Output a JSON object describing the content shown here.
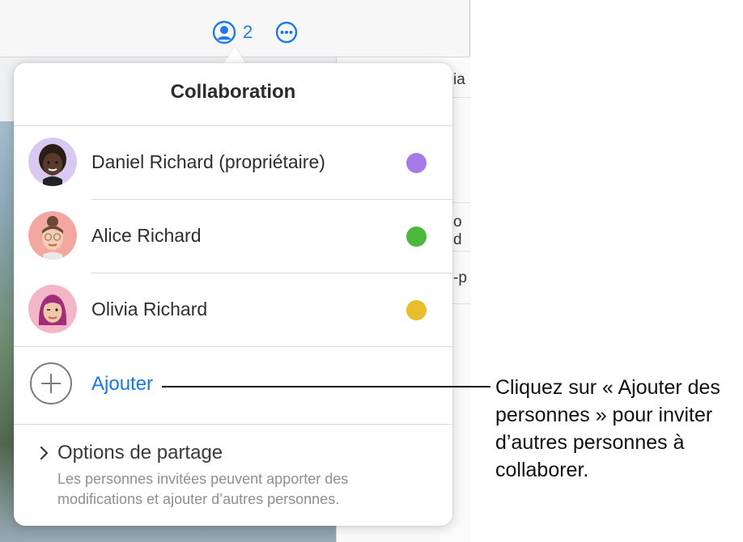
{
  "toolbar": {
    "collaborator_count": "2",
    "collab_icon": "person-circle-icon",
    "more_icon": "ellipsis-circle-icon"
  },
  "background_fragments": {
    "frag1": "ia",
    "frag2": "o d",
    "frag3": "-p"
  },
  "popover": {
    "title": "Collaboration",
    "people": [
      {
        "name": "Daniel Richard (propriétaire)",
        "color": "#a57bea",
        "avatar_icon": "memoji-avatar-icon"
      },
      {
        "name": "Alice Richard",
        "color": "#4cb93c",
        "avatar_icon": "memoji-avatar-icon"
      },
      {
        "name": "Olivia Richard",
        "color": "#e6bf2a",
        "avatar_icon": "memoji-avatar-icon"
      }
    ],
    "add": {
      "label": "Ajouter",
      "icon": "plus-circle-icon"
    },
    "options": {
      "chevron_icon": "chevron-right-icon",
      "title": "Options de partage",
      "description": "Les personnes invitées peuvent apporter des modifications et ajouter d’autres personnes."
    }
  },
  "callout": {
    "text": "Cliquez sur « Ajouter des personnes » pour inviter d’autres personnes à collaborer."
  },
  "colors": {
    "accent": "#1877e6"
  }
}
